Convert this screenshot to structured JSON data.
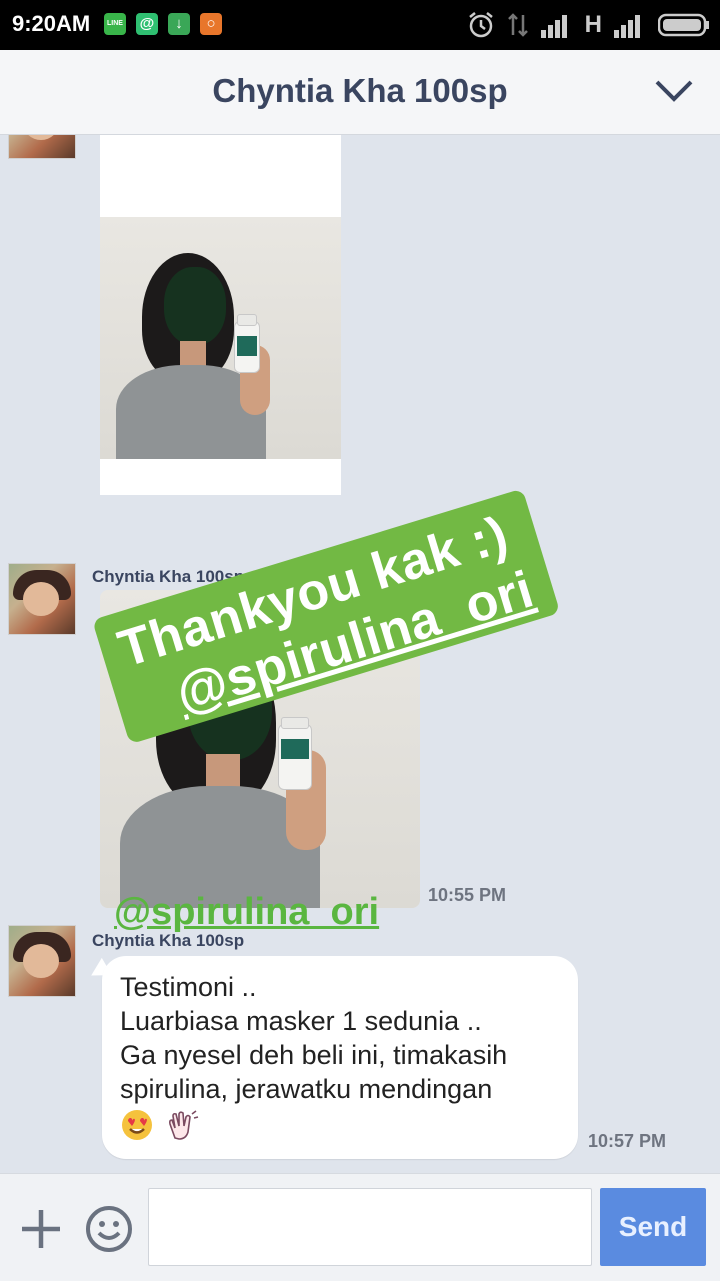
{
  "status_bar": {
    "time": "9:20AM",
    "notifications": [
      {
        "name": "line-notification-icon",
        "text": "LINE",
        "color": "#39b54a"
      },
      {
        "name": "at-notification-icon",
        "text": "@",
        "color": "#2fbf71"
      },
      {
        "name": "download-notification-icon",
        "text": "↓",
        "color": "#3aa757"
      },
      {
        "name": "app-notification-icon",
        "text": "○",
        "color": "#e8762b"
      }
    ],
    "network_label": "H"
  },
  "header": {
    "title": "Chyntia Kha 100sp",
    "collapse_icon": "chevron-down-icon"
  },
  "messages": [
    {
      "type": "image",
      "sender": "Chyntia Kha 100sp"
    },
    {
      "type": "image",
      "sender": "Chyntia Kha 100sp",
      "time": "10:55 PM"
    },
    {
      "type": "text",
      "sender": "Chyntia Kha 100sp",
      "lines": [
        "Testimoni ..",
        "Luarbiasa masker 1 sedunia ..",
        "Ga nyesel deh beli ini, timakasih",
        "spirulina, jerawatku mendingan"
      ],
      "emojis": [
        "heart-eyes-emoji",
        "clapping-hands-emoji"
      ],
      "time": "10:57 PM"
    }
  ],
  "overlay": {
    "sticker_line1": "Thankyou kak :)",
    "sticker_line2": "@spirulina_ori",
    "watermark": "@spirulina_ori",
    "color": "#72b944"
  },
  "input_bar": {
    "plus_icon": "plus-icon",
    "emoji_icon": "smiley-icon",
    "placeholder": "",
    "send_label": "Send",
    "send_color": "#5a8be0"
  }
}
